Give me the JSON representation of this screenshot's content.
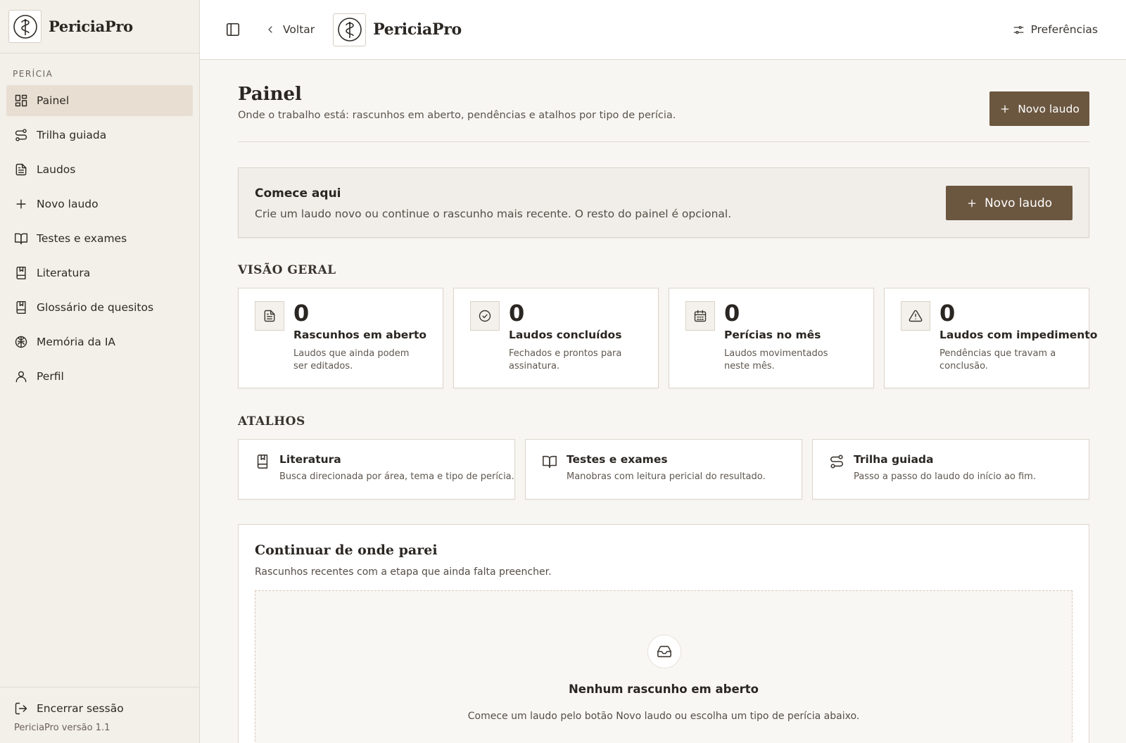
{
  "brand": {
    "name": "PericiaPro"
  },
  "sidebar": {
    "section": "PERÍCIA",
    "items": [
      {
        "label": "Painel"
      },
      {
        "label": "Trilha guiada"
      },
      {
        "label": "Laudos"
      },
      {
        "label": "Novo laudo"
      },
      {
        "label": "Testes e exames"
      },
      {
        "label": "Literatura"
      },
      {
        "label": "Glossário de quesitos"
      },
      {
        "label": "Memória da IA"
      },
      {
        "label": "Perfil"
      }
    ],
    "logout": "Encerrar sessão",
    "version": "PericiaPro versão 1.1"
  },
  "topbar": {
    "back": "Voltar",
    "brand": "PericiaPro",
    "prefs": "Preferências"
  },
  "page": {
    "title": "Painel",
    "subtitle": "Onde o trabalho está: rascunhos em aberto, pendências e atalhos por tipo de perícia.",
    "new_button": "Novo laudo"
  },
  "start": {
    "title": "Comece aqui",
    "text": "Crie um laudo novo ou continue o rascunho mais recente. O resto do painel é opcional.",
    "button": "Novo laudo"
  },
  "overview": {
    "title": "VISÃO GERAL",
    "cards": [
      {
        "value": "0",
        "label": "Rascunhos em aberto",
        "desc": "Laudos que ainda podem ser editados.",
        "icon": "file-text-icon"
      },
      {
        "value": "0",
        "label": "Laudos concluídos",
        "desc": "Fechados e prontos para assinatura.",
        "icon": "check-circle-icon"
      },
      {
        "value": "0",
        "label": "Perícias no mês",
        "desc": "Laudos movimentados neste mês.",
        "icon": "calendar-icon"
      },
      {
        "value": "0",
        "label": "Laudos com impedimento",
        "desc": "Pendências que travam a conclusão.",
        "icon": "alert-triangle-icon"
      }
    ]
  },
  "shortcuts": {
    "title": "ATALHOS",
    "items": [
      {
        "title": "Literatura",
        "desc": "Busca direcionada por área, tema e tipo de perícia.",
        "icon": "book-bookmark-icon"
      },
      {
        "title": "Testes e exames",
        "desc": "Manobras com leitura pericial do resultado.",
        "icon": "open-book-icon"
      },
      {
        "title": "Trilha guiada",
        "desc": "Passo a passo do laudo do início ao fim.",
        "icon": "route-icon"
      }
    ]
  },
  "continue": {
    "title": "Continuar de onde parei",
    "subtitle": "Rascunhos recentes com a etapa que ainda falta preencher.",
    "empty_title": "Nenhum rascunho em aberto",
    "empty_text": "Comece um laudo pelo botão Novo laudo ou escolha um tipo de perícia abaixo."
  },
  "colors": {
    "accent": "#6b563f",
    "sidebar_bg": "#f3efe9",
    "active_bg": "#e8dfd2",
    "page_bg": "#f8f6f3"
  }
}
